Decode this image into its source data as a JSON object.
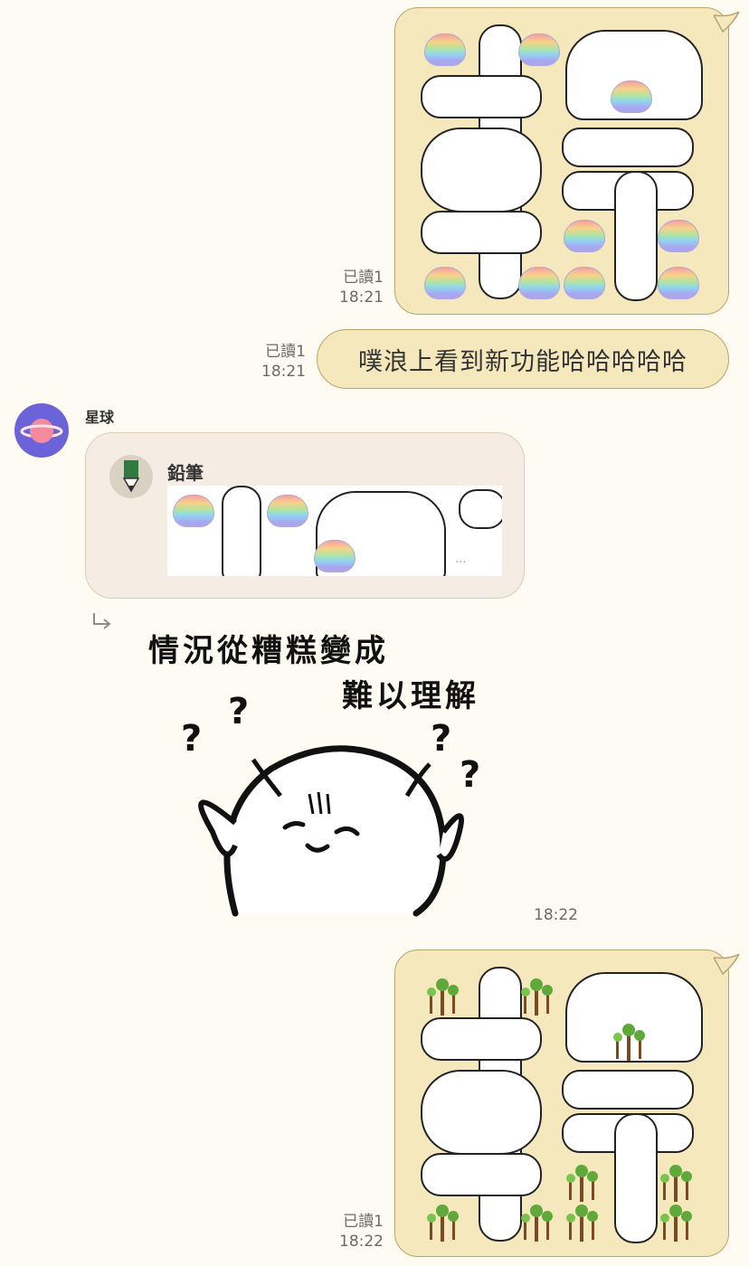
{
  "messages": {
    "m1": {
      "read_status": "已讀1",
      "time": "18:21",
      "sticker": "rainbow-blob-text-sticker"
    },
    "m2": {
      "read_status": "已讀1",
      "time": "18:21",
      "text": "噗浪上看到新功能哈哈哈哈哈"
    },
    "m3": {
      "sender": "星球",
      "reply": {
        "author": "鉛筆",
        "ellipsis": "..."
      },
      "caption_line1": "情況從糟糕變成",
      "caption_line2": "難以理解",
      "time": "18:22"
    },
    "m4": {
      "read_status": "已讀1",
      "time": "18:22",
      "sticker": "tree-text-sticker"
    }
  },
  "colors": {
    "outgoing_bubble": "#f6e8bd",
    "bubble_border": "#b9a46a",
    "avatar": "#6d63d9",
    "reply_card": "#f5ede3",
    "background": "#fefbf3"
  }
}
